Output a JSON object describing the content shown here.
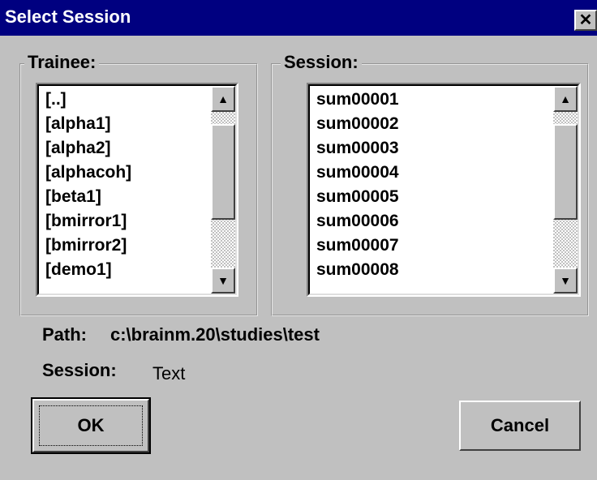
{
  "window": {
    "title": "Select Session",
    "close_glyph": "✕"
  },
  "trainee": {
    "legend": "Trainee:",
    "items": [
      "[..]",
      "[alpha1]",
      "[alpha2]",
      "[alphacoh]",
      "[beta1]",
      "[bmirror1]",
      "[bmirror2]",
      "[demo1]"
    ],
    "scroll_position": 0.8
  },
  "session_group": {
    "legend": "Session:",
    "items": [
      "sum00001",
      "sum00002",
      "sum00003",
      "sum00004",
      "sum00005",
      "sum00006",
      "sum00007",
      "sum00008"
    ],
    "scroll_position": 0.8
  },
  "path": {
    "label": "Path:",
    "value": "c:\\brainm.20\\studies\\test"
  },
  "session_field": {
    "label": "Session:",
    "value": "Text"
  },
  "buttons": {
    "ok": "OK",
    "cancel": "Cancel"
  },
  "icons": {
    "up": "▲",
    "down": "▼"
  }
}
